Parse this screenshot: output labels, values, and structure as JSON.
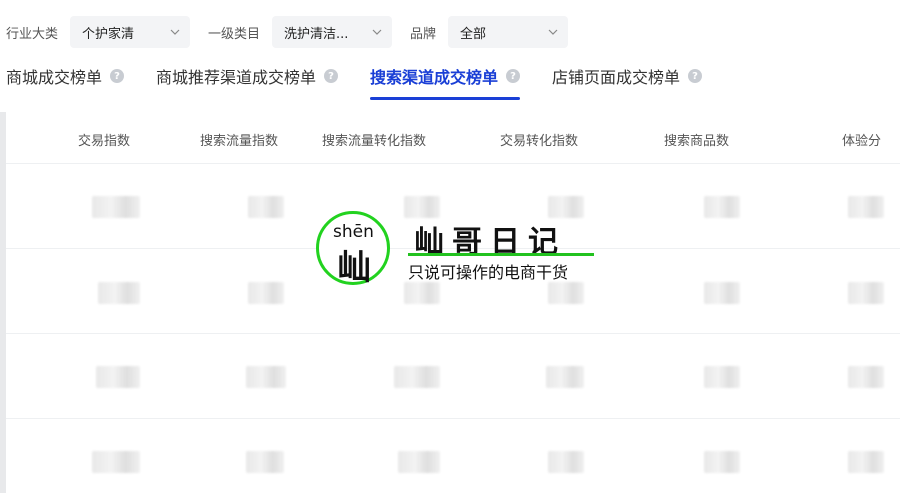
{
  "filters": {
    "industry_label": "行业大类",
    "industry_value": "个护家清",
    "category_label": "一级类目",
    "category_value": "洗护清洁...",
    "brand_label": "品牌",
    "brand_value": "全部"
  },
  "tabs": [
    {
      "label": "商城成交榜单",
      "active": false
    },
    {
      "label": "商城推荐渠道成交榜单",
      "active": false
    },
    {
      "label": "搜索渠道成交榜单",
      "active": true
    },
    {
      "label": "店铺页面成交榜单",
      "active": false
    }
  ],
  "table": {
    "columns": [
      "交易指数",
      "搜索流量指数",
      "搜索流量转化指数",
      "交易转化指数",
      "搜索商品数",
      "体验分"
    ]
  },
  "watermark": {
    "pinyin": "shēn",
    "char": "屾",
    "title": "屾哥日记",
    "subtitle": "只说可操作的电商干货"
  },
  "colors": {
    "accent": "#1a3fd6",
    "logo_green": "#22d21f"
  }
}
